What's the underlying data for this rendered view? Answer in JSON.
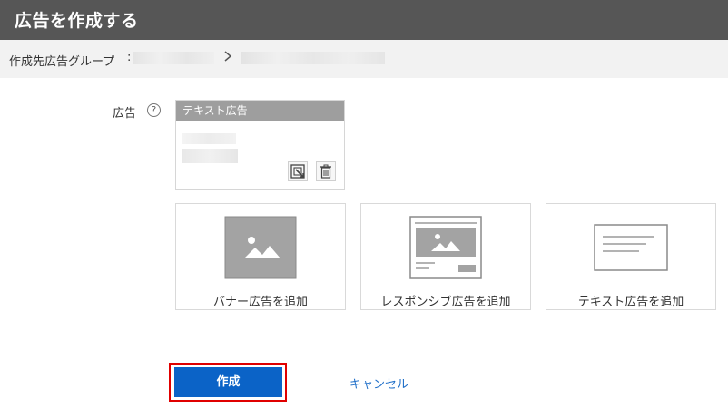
{
  "header": {
    "title": "広告を作成する"
  },
  "breadcrumb": {
    "label": "作成先広告グループ",
    "colon": ":",
    "separator_icon": "chevron-right-icon"
  },
  "ad_field": {
    "label": "広告",
    "help_icon": "question-circle-icon",
    "help_glyph": "?",
    "card": {
      "header": "テキスト広告",
      "actions": [
        "edit-icon",
        "trash-icon"
      ]
    }
  },
  "add_tiles": [
    {
      "label": "バナー広告を追加",
      "icon": "banner-image-icon"
    },
    {
      "label": "レスポンシブ広告を追加",
      "icon": "responsive-ad-icon"
    },
    {
      "label": "テキスト広告を追加",
      "icon": "text-ad-icon"
    }
  ],
  "actions": {
    "create_label": "作成",
    "cancel_label": "キャンセル"
  },
  "colors": {
    "header_bg": "#565656",
    "primary": "#0b63c7",
    "link": "#1e6ec8",
    "highlight": "#e00000"
  }
}
